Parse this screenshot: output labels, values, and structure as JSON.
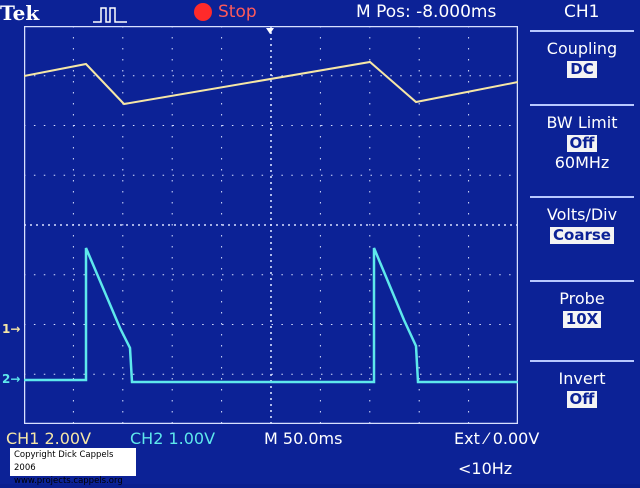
{
  "header": {
    "brand": "Tek",
    "run_state": "Stop",
    "horizontal_position": "M Pos: -8.000ms",
    "menu_title": "CH1"
  },
  "menu": [
    {
      "label": "Coupling",
      "value": "DC"
    },
    {
      "label": "BW Limit",
      "value": "Off",
      "sub": "60MHz"
    },
    {
      "label": "Volts/Div",
      "value": "Coarse"
    },
    {
      "label": "Probe",
      "value": "10X"
    },
    {
      "label": "Invert",
      "value": "Off"
    }
  ],
  "status": {
    "ch1_scale": "CH1  2.00V",
    "ch2_scale": "CH2  1.00V",
    "time_scale": "M 50.0ms",
    "trigger": "Ext  ⁄  0.00V",
    "frequency": "<10Hz"
  },
  "markers": {
    "ch1": "1→",
    "ch2": "2→"
  },
  "copyright": [
    "Copyright Dick Cappels 2006",
    "www.projects.cappels.org"
  ],
  "colors": {
    "ch1": "#f6e7a6",
    "ch2": "#5ee8ec",
    "screen": "#0c2296",
    "grid": "#d8e0ff",
    "stop": "#ff2a2a"
  }
}
